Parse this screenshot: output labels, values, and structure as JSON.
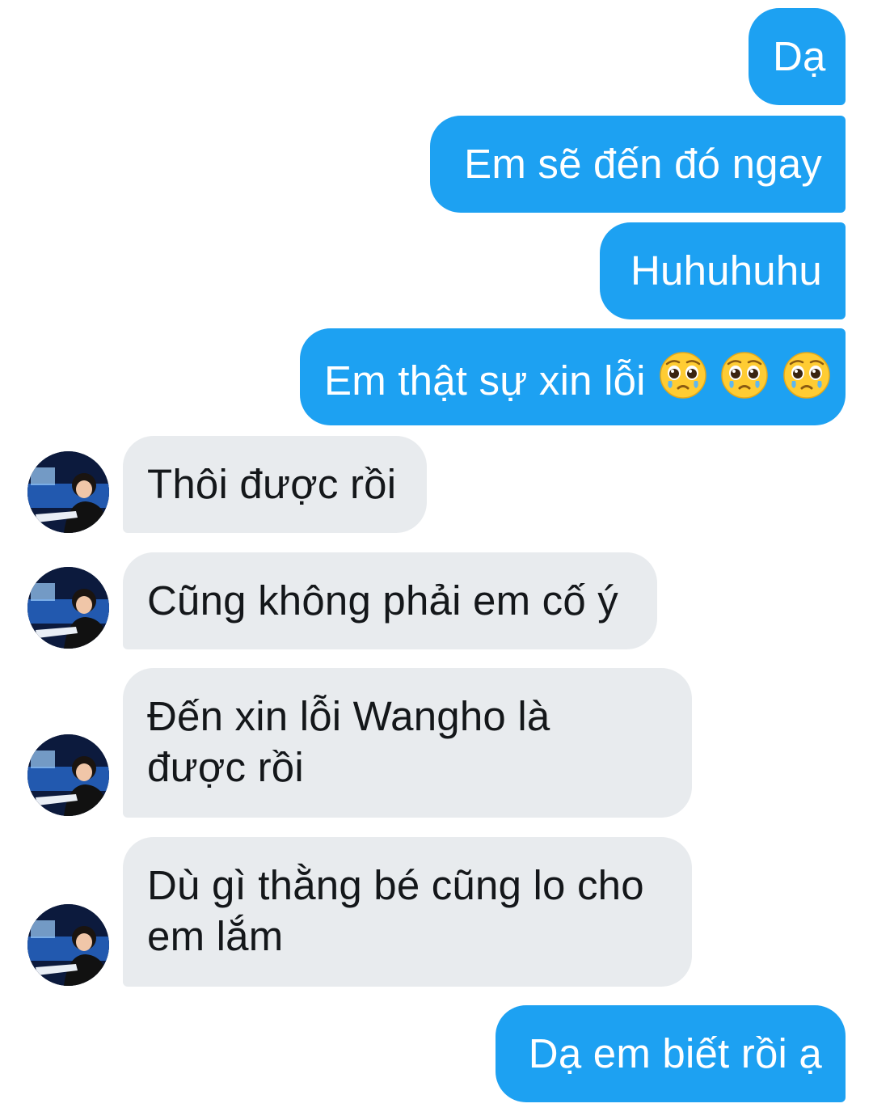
{
  "conversation": {
    "messages": [
      {
        "id": "m1",
        "direction": "outgoing",
        "text": "Dạ"
      },
      {
        "id": "m2",
        "direction": "outgoing",
        "text": "Em sẽ đến đó ngay"
      },
      {
        "id": "m3",
        "direction": "outgoing",
        "text": "Huhuhuhu"
      },
      {
        "id": "m4",
        "direction": "outgoing",
        "text": "Em thật sự xin lỗi",
        "emoji": [
          "pleading-face",
          "pleading-face",
          "pleading-face"
        ]
      },
      {
        "id": "m5",
        "direction": "incoming",
        "text": "Thôi được rồi"
      },
      {
        "id": "m6",
        "direction": "incoming",
        "text": "Cũng không phải em cố ý"
      },
      {
        "id": "m7",
        "direction": "incoming",
        "text": "Đến xin lỗi Wangho là được rồi"
      },
      {
        "id": "m8",
        "direction": "incoming",
        "text": "Dù gì thằng bé cũng lo cho em lắm"
      },
      {
        "id": "m9",
        "direction": "outgoing",
        "text": "Dạ em biết rồi ạ"
      }
    ]
  },
  "colors": {
    "outgoing_bubble": "#1da1f2",
    "incoming_bubble": "#e8ebee",
    "incoming_text": "#14171a",
    "outgoing_text": "#ffffff",
    "background": "#ffffff"
  },
  "icons": {
    "emoji": "pleading-face",
    "avatar": "contact-avatar"
  }
}
